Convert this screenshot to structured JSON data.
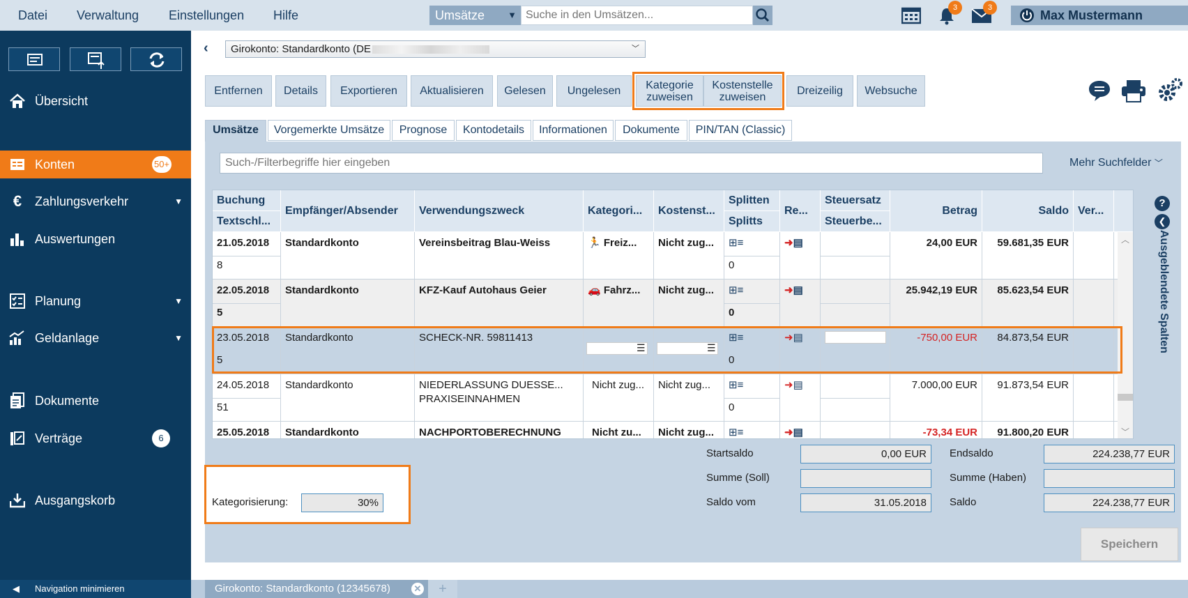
{
  "menu": {
    "datei": "Datei",
    "verwaltung": "Verwaltung",
    "einstellungen": "Einstellungen",
    "hilfe": "Hilfe"
  },
  "search": {
    "scope": "Umsätze",
    "placeholder": "Suche in den Umsätzen..."
  },
  "notifications": {
    "bell_count": "3",
    "mail_count": "3"
  },
  "user": {
    "name": "Max Mustermann"
  },
  "sidebar": {
    "items": [
      {
        "label": "Übersicht"
      },
      {
        "label": "Konten",
        "badge": "50+"
      },
      {
        "label": "Zahlungsverkehr"
      },
      {
        "label": "Auswertungen"
      },
      {
        "label": "Planung"
      },
      {
        "label": "Geldanlage"
      },
      {
        "label": "Dokumente"
      },
      {
        "label": "Verträge",
        "badge": "6"
      },
      {
        "label": "Ausgangskorb"
      }
    ],
    "minimize": "Navigation minimieren"
  },
  "account": {
    "selected": "Girokonto: Standardkonto (DE"
  },
  "toolbar": {
    "entfernen": "Entfernen",
    "details": "Details",
    "exportieren": "Exportieren",
    "aktualisieren": "Aktualisieren",
    "gelesen": "Gelesen",
    "ungelesen": "Ungelesen",
    "kategorie_1": "Kategorie",
    "kategorie_2": "zuweisen",
    "kostenstelle_1": "Kostenstelle",
    "kostenstelle_2": "zuweisen",
    "dreizeilig": "Dreizeilig",
    "websuche": "Websuche"
  },
  "tabs": [
    "Umsätze",
    "Vorgemerkte Umsätze",
    "Prognose",
    "Kontodetails",
    "Informationen",
    "Dokumente",
    "PIN/TAN (Classic)"
  ],
  "filter": {
    "placeholder": "Such-/Filterbegriffe hier eingeben",
    "more": "Mehr Suchfelder"
  },
  "columns": {
    "buchung": "Buchung",
    "textschl": "Textschl...",
    "empfaenger": "Empfänger/Absender",
    "zweck": "Verwendungszweck",
    "kategorie": "Kategori...",
    "kostenst": "Kostenst...",
    "splitten": "Splitten",
    "splitts": "Splitts",
    "re": "Re...",
    "steuersatz": "Steuersatz",
    "steuerbe": "Steuerbe...",
    "betrag": "Betrag",
    "saldo": "Saldo",
    "ver": "Ver..."
  },
  "rows": [
    {
      "date": "21.05.2018",
      "key": "8",
      "party": "Standardkonto",
      "purpose": "Vereinsbeitrag Blau-Weiss",
      "purpose2": "",
      "category": "Freiz...",
      "cost": "Nicht zug...",
      "splits": "0",
      "amount": "24,00 EUR",
      "balance": "59.681,35 EUR"
    },
    {
      "date": "22.05.2018",
      "key": "5",
      "party": "Standardkonto",
      "purpose": "KFZ-Kauf Autohaus Geier",
      "purpose2": "",
      "category": "Fahrz...",
      "cost": "Nicht zug...",
      "splits": "0",
      "amount": "25.942,19 EUR",
      "balance": "85.623,54 EUR"
    },
    {
      "date": "23.05.2018",
      "key": "5",
      "party": "Standardkonto",
      "purpose": "SCHECK-NR. 59811413",
      "purpose2": "",
      "category": "",
      "cost": "",
      "splits": "0",
      "amount": "-750,00 EUR",
      "balance": "84.873,54 EUR"
    },
    {
      "date": "24.05.2018",
      "key": "51",
      "party": "Standardkonto",
      "purpose": "NIEDERLASSUNG DUESSE...",
      "purpose2": "PRAXISEINNAHMEN",
      "category": "Nicht zug...",
      "cost": "Nicht zug...",
      "splits": "0",
      "amount": "7.000,00 EUR",
      "balance": "91.873,54 EUR"
    },
    {
      "date": "25.05.2018",
      "key": "",
      "party": "Standardkonto",
      "purpose": "NACHPORTOBERECHNUNG",
      "purpose2": "",
      "category": "Nicht zu...",
      "cost": "Nicht zug...",
      "splits": "",
      "amount": "-73,34 EUR",
      "balance": "91.800,20 EUR"
    }
  ],
  "side_panel": {
    "label": "Ausgeblendete Spalten"
  },
  "summary": {
    "startsaldo_label": "Startsaldo",
    "startsaldo": "0,00 EUR",
    "soll_label": "Summe (Soll)",
    "soll": "",
    "saldo_vom_label": "Saldo vom",
    "saldo_vom": "31.05.2018",
    "endsaldo_label": "Endsaldo",
    "endsaldo": "224.238,77 EUR",
    "haben_label": "Summe (Haben)",
    "haben": "",
    "saldo_label": "Saldo",
    "saldo": "224.238,77 EUR",
    "kategorisierung_label": "Kategorisierung:",
    "kategorisierung": "30%"
  },
  "save": "Speichern",
  "doc_tab": {
    "label": "Girokonto: Standardkonto (12345678)"
  },
  "colors": {
    "accent": "#f07b18",
    "navy": "#0c3a5e",
    "negative": "#d42424"
  }
}
